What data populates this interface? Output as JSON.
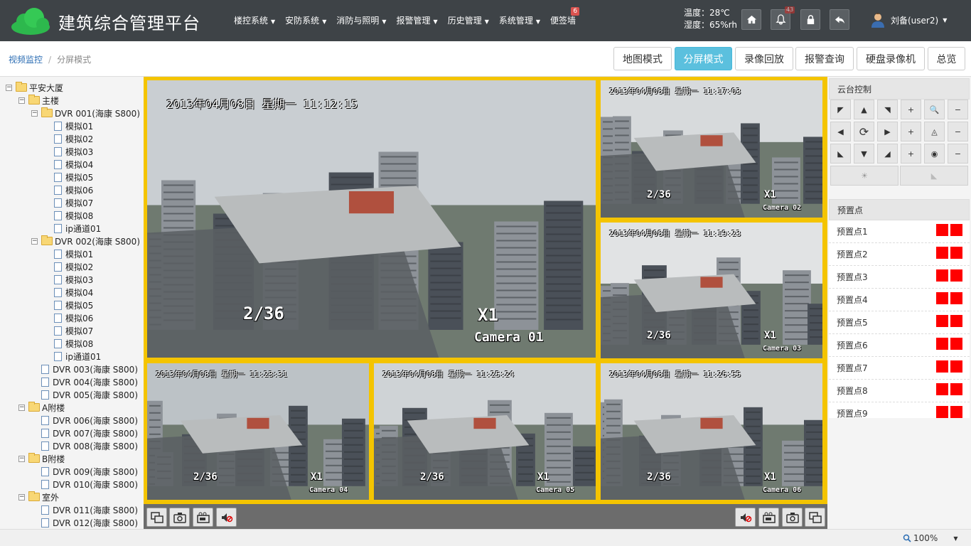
{
  "header": {
    "title": "建筑综合管理平台",
    "nav": [
      {
        "label": "楼控系统"
      },
      {
        "label": "安防系统"
      },
      {
        "label": "消防与照明"
      },
      {
        "label": "报警管理"
      },
      {
        "label": "历史管理"
      },
      {
        "label": "系统管理"
      },
      {
        "label": "便签墙",
        "badge": "6"
      }
    ],
    "temperature": "温度：28℃",
    "humidity": "湿度：65%rh",
    "bell_badge": "43",
    "user": "刘备(user2)"
  },
  "breadcrumb": {
    "parent": "视频监控",
    "separator": "/",
    "current": "分屏模式"
  },
  "tabs": [
    "地图模式",
    "分屏模式",
    "录像回放",
    "报警查询",
    "硬盘录像机",
    "总览"
  ],
  "active_tab": "分屏模式",
  "tree": [
    {
      "label": "平安大厦",
      "type": "folder",
      "toggle": "⊟"
    },
    {
      "label": "主楼",
      "type": "folder",
      "toggle": "⊟"
    },
    {
      "label": "DVR 001(海康 S800)",
      "type": "folder",
      "toggle": "⊟"
    },
    {
      "label": "模拟01",
      "type": "doc"
    },
    {
      "label": "模拟02",
      "type": "doc"
    },
    {
      "label": "模拟03",
      "type": "doc"
    },
    {
      "label": "模拟04",
      "type": "doc"
    },
    {
      "label": "模拟05",
      "type": "doc"
    },
    {
      "label": "模拟06",
      "type": "doc"
    },
    {
      "label": "模拟07",
      "type": "doc"
    },
    {
      "label": "模拟08",
      "type": "doc"
    },
    {
      "label": "ip通道01",
      "type": "doc"
    },
    {
      "label": "DVR 002(海康 S800)",
      "type": "folder",
      "toggle": "⊟"
    },
    {
      "label": "模拟01",
      "type": "doc"
    },
    {
      "label": "模拟02",
      "type": "doc"
    },
    {
      "label": "模拟03",
      "type": "doc"
    },
    {
      "label": "模拟04",
      "type": "doc"
    },
    {
      "label": "模拟05",
      "type": "doc"
    },
    {
      "label": "模拟06",
      "type": "doc"
    },
    {
      "label": "模拟07",
      "type": "doc"
    },
    {
      "label": "模拟08",
      "type": "doc"
    },
    {
      "label": "ip通道01",
      "type": "doc"
    },
    {
      "label": "DVR 003(海康 S800)",
      "type": "doc"
    },
    {
      "label": "DVR 004(海康 S800)",
      "type": "doc"
    },
    {
      "label": "DVR 005(海康 S800)",
      "type": "doc"
    },
    {
      "label": "A附楼",
      "type": "folder",
      "toggle": "⊟"
    },
    {
      "label": "DVR 006(海康 S800)",
      "type": "doc"
    },
    {
      "label": "DVR 007(海康 S800)",
      "type": "doc"
    },
    {
      "label": "DVR 008(海康 S800)",
      "type": "doc"
    },
    {
      "label": "B附楼",
      "type": "folder",
      "toggle": "⊟"
    },
    {
      "label": "DVR 009(海康 S800)",
      "type": "doc"
    },
    {
      "label": "DVR 010(海康 S800)",
      "type": "doc"
    },
    {
      "label": "室外",
      "type": "folder",
      "toggle": "⊟"
    },
    {
      "label": "DVR 011(海康 S800)",
      "type": "doc"
    },
    {
      "label": "DVR 012(海康 S800)",
      "type": "doc"
    }
  ],
  "cameras": [
    {
      "timestamp": "2013年04月08日  星期一  11:12:15",
      "channel": "2/36",
      "zoom": "X1",
      "name": "Camera 01"
    },
    {
      "timestamp": "2013年04月08日  星期一  11:17:03",
      "channel": "2/36",
      "zoom": "X1",
      "name": "Camera 02"
    },
    {
      "timestamp": "2013年04月08日  星期一  11:19:23",
      "channel": "2/36",
      "zoom": "X1",
      "name": "Camera 03"
    },
    {
      "timestamp": "2013年04月08日  星期一  11:23:31",
      "channel": "2/36",
      "zoom": "X1",
      "name": "Camera 04"
    },
    {
      "timestamp": "2013年04月08日  星期一  11:25:24",
      "channel": "2/36",
      "zoom": "X1",
      "name": "Camera 05"
    },
    {
      "timestamp": "2013年04月08日  星期一  11:26:55",
      "channel": "2/36",
      "zoom": "X1",
      "name": "Camera 06"
    }
  ],
  "ptz": {
    "title": "云台控制",
    "buttons": [
      "arrow-up-left",
      "arrow-up",
      "arrow-up-right",
      "zoom-in",
      "zoom",
      "zoom-out",
      "arrow-left",
      "rotate",
      "arrow-right",
      "focus-in",
      "focus",
      "focus-out",
      "arrow-down-left",
      "arrow-down",
      "arrow-down-right",
      "iris-in",
      "iris",
      "iris-out",
      "light",
      "wiper"
    ]
  },
  "presets": {
    "title": "预置点",
    "items": [
      "预置点1",
      "预置点2",
      "预置点3",
      "预置点4",
      "预置点5",
      "预置点6",
      "预置点7",
      "预置点8",
      "预置点9"
    ]
  },
  "status": {
    "zoom": "100%"
  },
  "colors": {
    "topbar": "#3e4347",
    "accent": "#5bc0de",
    "grid_border": "#f4c400",
    "preset_button": "#ff0000"
  }
}
